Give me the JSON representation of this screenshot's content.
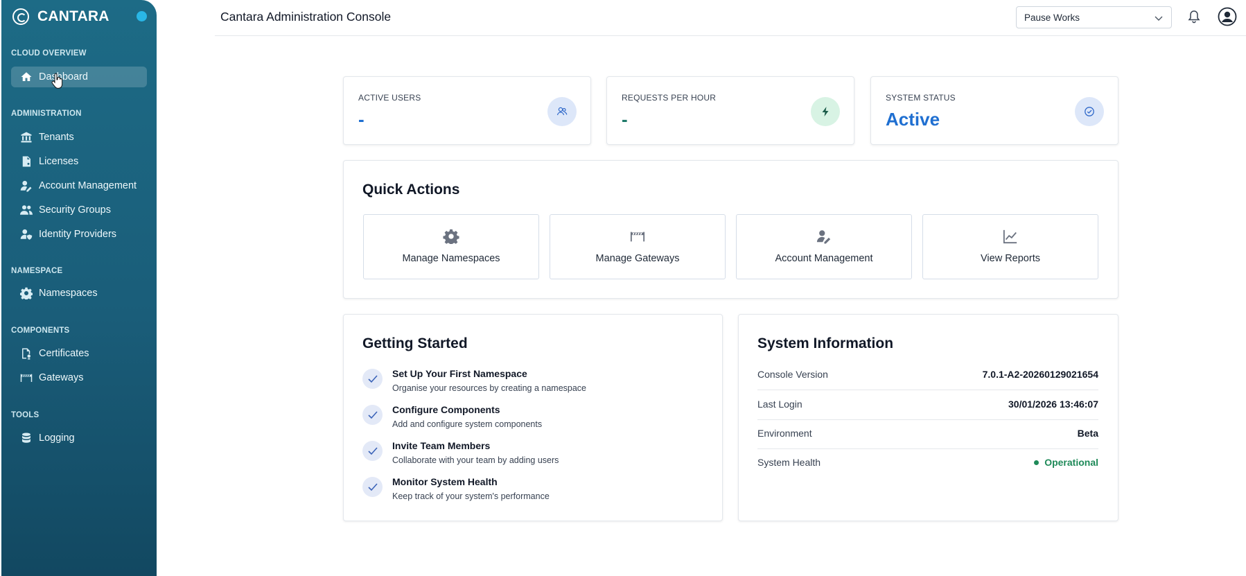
{
  "sidebar": {
    "brand": "CANTARA",
    "sections": {
      "cloud_overview": "CLOUD OVERVIEW",
      "administration": "ADMINISTRATION",
      "namespace": "NAMESPACE",
      "components": "COMPONENTS",
      "tools": "TOOLS"
    },
    "items": {
      "dashboard": "Dashboard",
      "tenants": "Tenants",
      "licenses": "Licenses",
      "account_management": "Account Management",
      "security_groups": "Security Groups",
      "identity_providers": "Identity Providers",
      "namespaces": "Namespaces",
      "certificates": "Certificates",
      "gateways": "Gateways",
      "logging": "Logging"
    }
  },
  "header": {
    "title": "Cantara Administration Console",
    "namespace_selected": "Pause Works"
  },
  "stats": {
    "active_users": {
      "label": "ACTIVE USERS",
      "value": "-"
    },
    "requests_per_hour": {
      "label": "REQUESTS PER HOUR",
      "value": "-"
    },
    "system_status": {
      "label": "SYSTEM STATUS",
      "value": "Active"
    }
  },
  "quick_actions": {
    "title": "Quick Actions",
    "items": [
      {
        "label": "Manage Namespaces",
        "icon": "gear-icon"
      },
      {
        "label": "Manage Gateways",
        "icon": "gateway-icon"
      },
      {
        "label": "Account Management",
        "icon": "user-edit-icon"
      },
      {
        "label": "View Reports",
        "icon": "chart-line-icon"
      }
    ]
  },
  "getting_started": {
    "title": "Getting Started",
    "items": [
      {
        "title": "Set Up Your First Namespace",
        "desc": "Organise your resources by creating a namespace"
      },
      {
        "title": "Configure Components",
        "desc": "Add and configure system components"
      },
      {
        "title": "Invite Team Members",
        "desc": "Collaborate with your team by adding users"
      },
      {
        "title": "Monitor System Health",
        "desc": "Keep track of your system's performance"
      }
    ]
  },
  "system_info": {
    "title": "System Information",
    "rows": [
      {
        "key": "Console Version",
        "value": "7.0.1-A2-20260129021654"
      },
      {
        "key": "Last Login",
        "value": "30/01/2026 13:46:07"
      },
      {
        "key": "Environment",
        "value": "Beta"
      },
      {
        "key": "System Health",
        "value": "Operational"
      }
    ]
  },
  "colors": {
    "sidebar": "#1a5d79",
    "accent_blue": "#1f6fd1",
    "accent_teal": "#1f7a6a",
    "operational_green": "#1f8a59"
  }
}
